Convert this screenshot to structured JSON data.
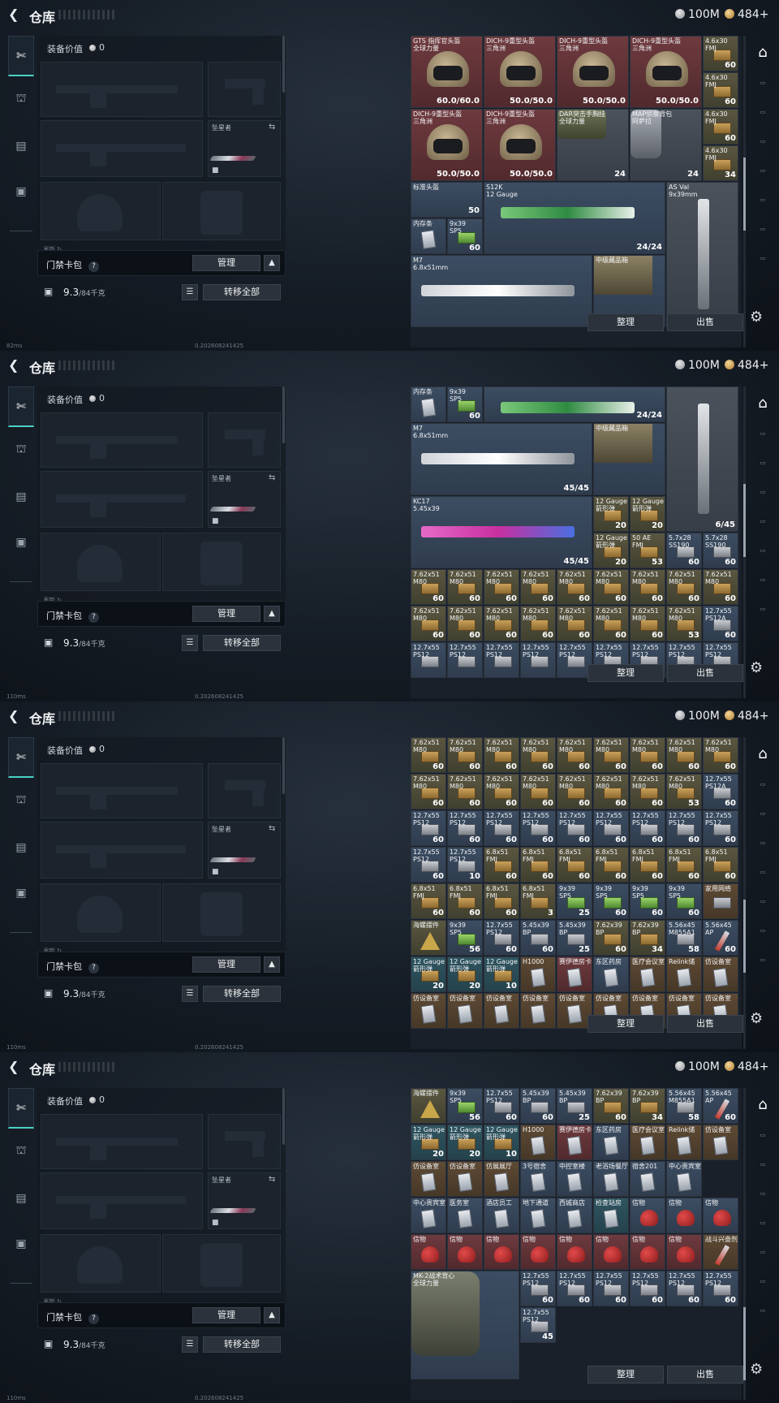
{
  "header": {
    "title": "仓库",
    "currency_silver": "100M",
    "currency_gold": "484+"
  },
  "loadout": {
    "value_label": "装备价值",
    "value": "0",
    "melee_label": "坠星者",
    "footer_note": "刷新 ↻",
    "card_pack_label": "门禁卡包",
    "manage_label": "管理",
    "weight": "9.3",
    "weight_cap": "/84千克",
    "transfer_all_label": "转移全部"
  },
  "grid": {
    "sort_label": "整理",
    "sell_label": "出售"
  },
  "status": {
    "frames": [
      {
        "ping": "82ms",
        "build": "0.202608241425"
      },
      {
        "ping": "110ms",
        "build": "0.202608241425"
      },
      {
        "ping": "110ms",
        "build": "0.202608241425"
      },
      {
        "ping": "110ms",
        "build": "0.202608241425"
      }
    ]
  },
  "items": {
    "frame1": [
      {
        "name": "GTS 指挥官头盔\n全球力量",
        "count": "60.0/60.0",
        "type": "helmet",
        "col": 0,
        "row": 0,
        "w": 2,
        "h": 2,
        "color": "red"
      },
      {
        "name": "DICH-9重型头盔\n三角洲",
        "count": "50.0/50.0",
        "type": "helmet",
        "col": 2,
        "row": 0,
        "w": 2,
        "h": 2,
        "color": "red"
      },
      {
        "name": "DICH-9重型头盔\n三角洲",
        "count": "50.0/50.0",
        "type": "helmet",
        "col": 4,
        "row": 0,
        "w": 2,
        "h": 2,
        "color": "red"
      },
      {
        "name": "DICH-9重型头盔\n三角洲",
        "count": "50.0/50.0",
        "type": "helmet",
        "col": 6,
        "row": 0,
        "w": 2,
        "h": 2,
        "color": "red"
      },
      {
        "name": "4.6x30\nFMJ",
        "count": "60",
        "type": "ammo",
        "col": 8,
        "row": 0,
        "color": "gold"
      },
      {
        "name": "4.6x30\nFMJ",
        "count": "60",
        "type": "ammo",
        "col": 8,
        "row": 1,
        "color": "gold"
      },
      {
        "name": "DICH-9重型头盔\n三角洲",
        "count": "50.0/50.0",
        "type": "helmet",
        "col": 0,
        "row": 2,
        "w": 2,
        "h": 2,
        "color": "red"
      },
      {
        "name": "DICH-9重型头盔\n三角洲",
        "count": "50.0/50.0",
        "type": "helmet",
        "col": 2,
        "row": 2,
        "w": 2,
        "h": 2,
        "color": "red"
      },
      {
        "name": "DAR突击手胸挂\n全球力量",
        "count": "24",
        "type": "rig",
        "col": 4,
        "row": 2,
        "w": 2,
        "h": 2,
        "color": "gray"
      },
      {
        "name": "MAP侦察背包\n阿萨拉",
        "count": "24",
        "type": "bag",
        "col": 6,
        "row": 2,
        "w": 2,
        "h": 2,
        "color": "gray"
      },
      {
        "name": "4.6x30\nFMJ",
        "count": "60",
        "type": "ammo",
        "col": 8,
        "row": 2,
        "color": "gold"
      },
      {
        "name": "4.6x30\nFMJ",
        "count": "34",
        "type": "ammo",
        "col": 8,
        "row": 3,
        "color": "gold"
      },
      {
        "name": "标准头盔",
        "count": "50",
        "type": "case",
        "col": 0,
        "row": 4,
        "w": 2,
        "h": 1,
        "color": "blue"
      },
      {
        "name": "S12K\n12 Gauge",
        "count": "24/24",
        "type": "gun-green",
        "col": 2,
        "row": 4,
        "w": 5,
        "h": 2,
        "color": "blue"
      },
      {
        "name": "AS Val\n9x39mm",
        "count": "",
        "type": "gun-vert",
        "col": 7,
        "row": 4,
        "w": 2,
        "h": 4,
        "color": "gray"
      },
      {
        "name": "内存条",
        "count": "",
        "type": "card",
        "col": 0,
        "row": 5,
        "color": "blue"
      },
      {
        "name": "9x39\nSP5",
        "count": "60",
        "type": "ammo-green",
        "col": 1,
        "row": 5,
        "color": "blue"
      },
      {
        "name": "M7\n6.8x51mm",
        "count": "",
        "type": "gun-white",
        "col": 0,
        "row": 6,
        "w": 5,
        "h": 2,
        "color": "blue"
      },
      {
        "name": "中级藏品箱",
        "count": "",
        "type": "chest",
        "col": 5,
        "row": 6,
        "w": 2,
        "h": 2,
        "color": "blue"
      }
    ]
  }
}
